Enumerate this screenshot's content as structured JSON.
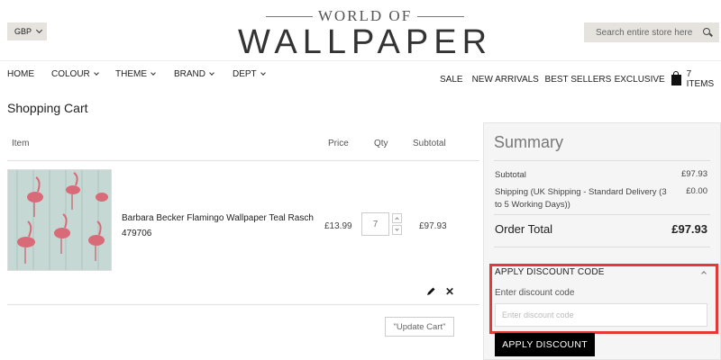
{
  "header": {
    "currency": "GBP",
    "logo_top": "WORLD OF",
    "logo_bottom": "WALLPAPER",
    "search_placeholder": "Search entire store here"
  },
  "nav": {
    "left": [
      {
        "label": "HOME",
        "has_caret": false
      },
      {
        "label": "COLOUR",
        "has_caret": true
      },
      {
        "label": "THEME",
        "has_caret": true
      },
      {
        "label": "BRAND",
        "has_caret": true
      },
      {
        "label": "DEPT",
        "has_caret": true
      }
    ],
    "right": [
      "SALE",
      "NEW ARRIVALS",
      "BEST SELLERS",
      "EXCLUSIVE"
    ],
    "cart_count": "7 ITEMS"
  },
  "page_title": "Shopping Cart",
  "cart": {
    "headers": {
      "item": "Item",
      "price": "Price",
      "qty": "Qty",
      "subtotal": "Subtotal"
    },
    "items": [
      {
        "name": "Barbara Becker Flamingo Wallpaper Teal Rasch 479706",
        "price": "£13.99",
        "qty": "7",
        "subtotal": "£97.93"
      }
    ],
    "update_label": "\"Update Cart\""
  },
  "summary": {
    "title": "Summary",
    "subtotal_label": "Subtotal",
    "subtotal_value": "£97.93",
    "shipping_label": "Shipping (UK Shipping - Standard Delivery (3 to 5 Working Days))",
    "shipping_value": "£0.00",
    "order_total_label": "Order Total",
    "order_total_value": "£97.93",
    "discount": {
      "title": "APPLY DISCOUNT CODE",
      "field_label": "Enter discount code",
      "placeholder": "Enter discount code",
      "button_label": "APPLY DISCOUNT"
    }
  }
}
